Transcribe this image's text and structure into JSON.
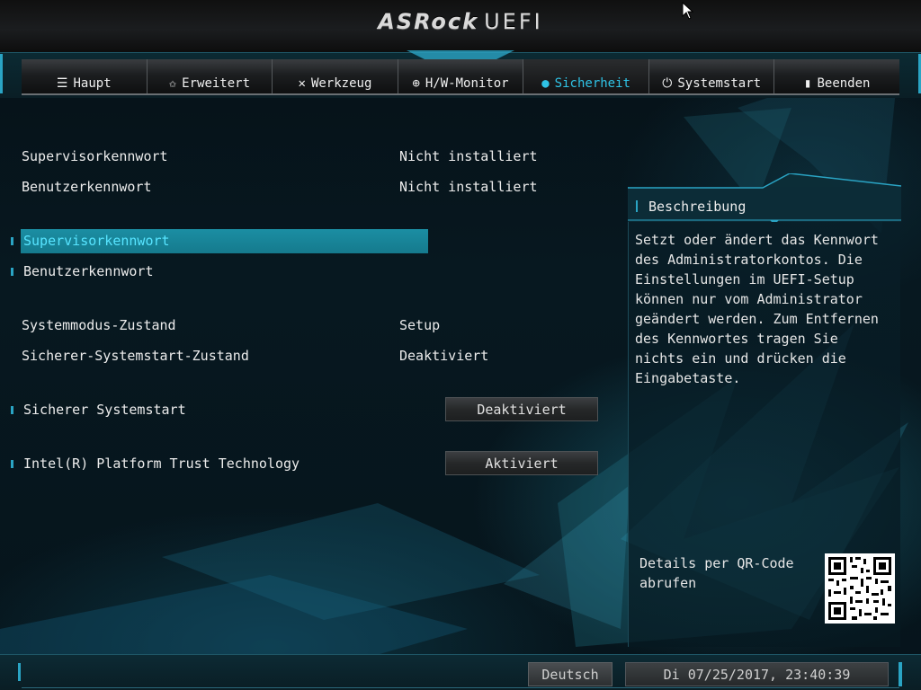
{
  "header": {
    "brand": "ASRock",
    "product": "UEFI"
  },
  "tabs": [
    {
      "label": "Haupt",
      "icon": "list-icon",
      "glyph": "☰"
    },
    {
      "label": "Erweitert",
      "icon": "star-icon",
      "glyph": "✩"
    },
    {
      "label": "Werkzeug",
      "icon": "wrench-icon",
      "glyph": "✕"
    },
    {
      "label": "H/W-Monitor",
      "icon": "monitor-icon",
      "glyph": "⊕"
    },
    {
      "label": "Sicherheit",
      "icon": "shield-icon",
      "glyph": "●",
      "active": true
    },
    {
      "label": "Systemstart",
      "icon": "power-icon",
      "glyph": "⏻"
    },
    {
      "label": "Beenden",
      "icon": "exit-icon",
      "glyph": "▮"
    }
  ],
  "main": {
    "supervisor_status": {
      "label": "Supervisorkennwort",
      "value": "Nicht installiert"
    },
    "user_status": {
      "label": "Benutzerkennwort",
      "value": "Nicht installiert"
    },
    "supervisor_item": {
      "label": "Supervisorkennwort"
    },
    "user_item": {
      "label": "Benutzerkennwort"
    },
    "system_mode": {
      "label": "Systemmodus-Zustand",
      "value": "Setup"
    },
    "secure_boot_state": {
      "label": "Sicherer-Systemstart-Zustand",
      "value": "Deaktiviert"
    },
    "secure_boot": {
      "label": "Sicherer Systemstart",
      "value": "Deaktiviert"
    },
    "intel_ptt": {
      "label": "Intel(R) Platform Trust Technology",
      "value": "Aktiviert"
    }
  },
  "description": {
    "title": "Beschreibung",
    "body": "Setzt oder ändert das Kennwort des Administratorkontos. Die Einstellungen im UEFI-Setup können nur vom Administrator geändert werden. Zum Entfernen des Kennwortes tragen Sie nichts ein und drücken die Eingabetaste.",
    "qr_text": "Details per QR-Code abrufen"
  },
  "footer": {
    "language": "Deutsch",
    "datetime": "Di 07/25/2017, 23:40:39"
  },
  "colors": {
    "accent": "#2aa4c4",
    "selected_bg": "#1b8ea3",
    "selected_text": "#57e4ff"
  }
}
